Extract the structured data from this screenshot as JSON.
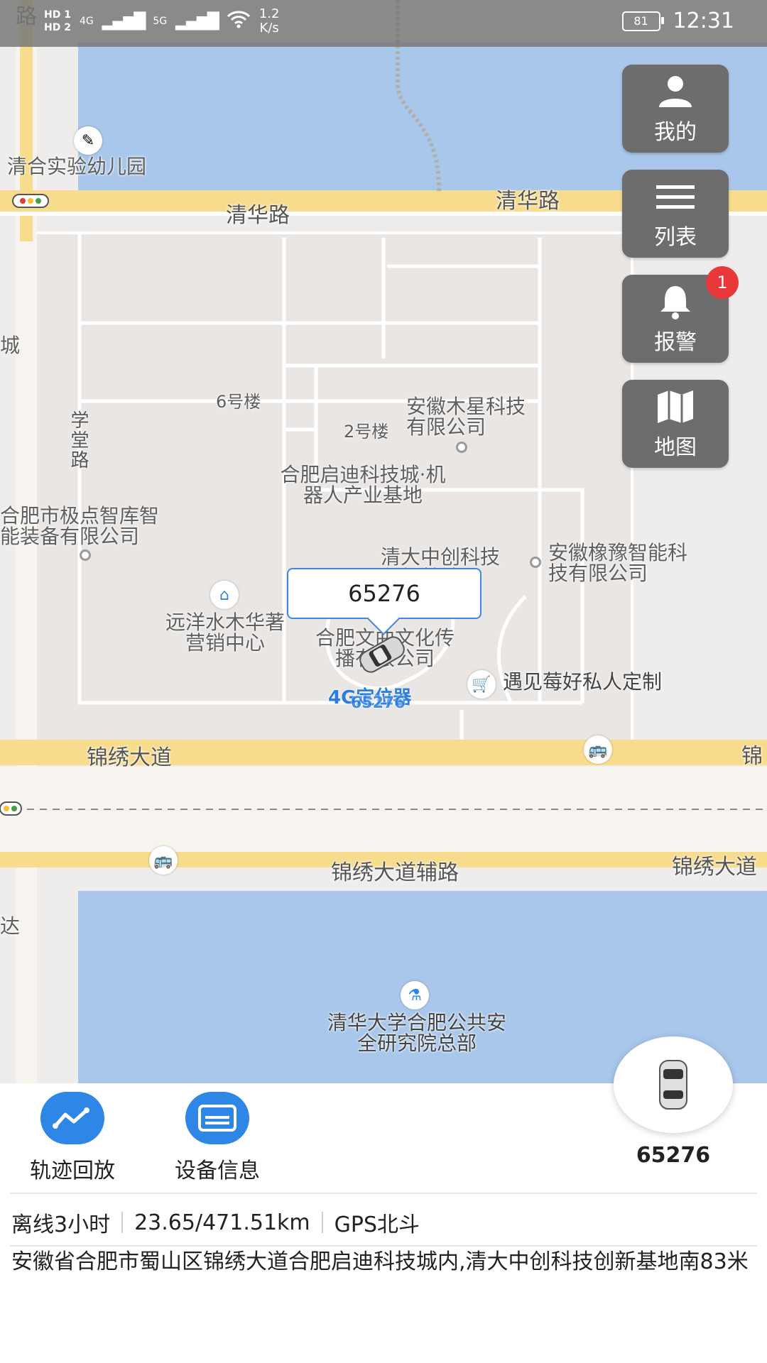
{
  "status_bar": {
    "hd1": "HD 1",
    "hd2": "HD 2",
    "net1": "4G",
    "net2": "5G",
    "speed_value": "1.2",
    "speed_unit": "K/s",
    "battery": "81",
    "time": "12:31"
  },
  "side_buttons": {
    "mine_label": "我的",
    "list_label": "列表",
    "alarm_label": "报警",
    "alarm_badge": "1",
    "map_label": "地图"
  },
  "map": {
    "roads": {
      "qinghua_left": "清华路",
      "qinghua_right": "清华路",
      "jinxiu_left": "锦绣大道",
      "jinxiu_right": "锦",
      "jinxiu_aux": "锦绣大道辅路",
      "jinxiu_right2": "锦绣大道",
      "xuetang": "学堂路",
      "top_left": "路"
    },
    "pois": {
      "kindergarten": "清合实验幼儿园",
      "cheng": "城",
      "bldg6": "6号楼",
      "bldg2": "2号楼",
      "muxing": "安徽木星科技有限公司",
      "qidi": "合肥启迪科技城·机器人产业基地",
      "jidian": "合肥市极点智库智能装备有限公司",
      "qingda": "清大中创科技创新基地",
      "xiangxiang": "安徽橡豫智能科技有限公司",
      "yuanyang": "远洋水木华著营销中心",
      "wenhua": "合肥文曲文化传播有限公司",
      "yujian": "遇见莓好私人定制",
      "da": "达",
      "research": "清华大学合肥公共安全研究院总部"
    },
    "callout": "65276",
    "car_label": "4G定位器",
    "car_label2": "65276"
  },
  "actions": {
    "track_label": "轨迹回放",
    "device_label": "设备信息"
  },
  "device": {
    "name": "65276",
    "status": "离线3小时",
    "mileage": "23.65/471.51km",
    "positioning": "GPS北斗",
    "address": "安徽省合肥市蜀山区锦绣大道合肥启迪科技城内,清大中创科技创新基地南83米"
  },
  "colors": {
    "accent": "#2e86e6",
    "button_bg": "#6d6d6d",
    "badge": "#e9383a",
    "water": "#a9c7ea",
    "road": "#f7dc8e"
  }
}
